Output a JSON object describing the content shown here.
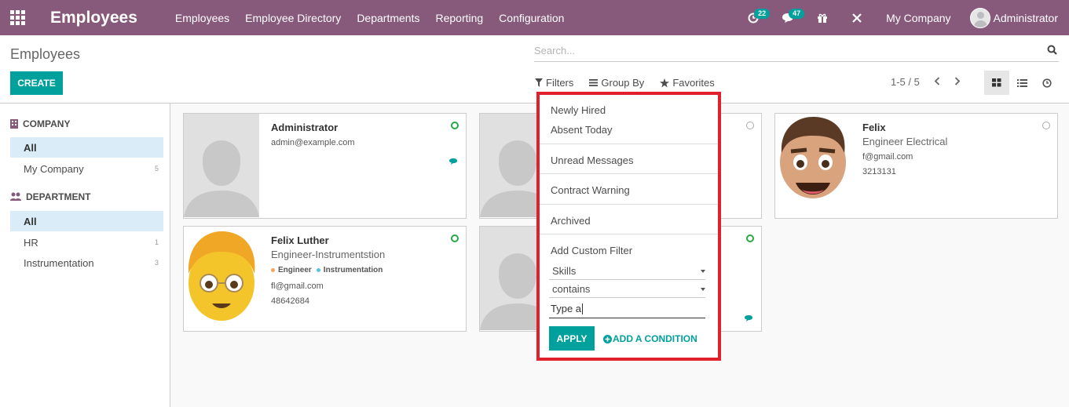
{
  "app": {
    "title": "Employees",
    "menu": [
      "Employees",
      "Employee Directory",
      "Departments",
      "Reporting",
      "Configuration"
    ],
    "activity_badge": "22",
    "messages_badge": "47",
    "company": "My Company",
    "user": "Administrator"
  },
  "control_panel": {
    "breadcrumb": "Employees",
    "create_label": "CREATE",
    "search_placeholder": "Search...",
    "filters_label": "Filters",
    "groupby_label": "Group By",
    "favorites_label": "Favorites",
    "pager": "1-5 / 5"
  },
  "sidebar": {
    "company_title": "COMPANY",
    "company_items": [
      {
        "label": "All",
        "count": ""
      },
      {
        "label": "My Company",
        "count": "5"
      }
    ],
    "department_title": "DEPARTMENT",
    "department_items": [
      {
        "label": "All",
        "count": ""
      },
      {
        "label": "HR",
        "count": "1"
      },
      {
        "label": "Instrumentation",
        "count": "3"
      }
    ]
  },
  "cards": [
    {
      "name": "Administrator",
      "email": "admin@example.com"
    },
    {
      "name": "Felix",
      "job": "Engineer Electrical",
      "email": "f@gmail.com",
      "phone": "3213131"
    },
    {
      "name": "Felix Luther",
      "job": "Engineer-Instrumentstion",
      "tags": [
        "Engineer",
        "Instrumentation"
      ],
      "email": "fl@gmail.com",
      "phone": "48642684"
    }
  ],
  "filter_dropdown": {
    "items": [
      "Newly Hired",
      "Absent Today",
      "Unread Messages",
      "Contract Warning",
      "Archived"
    ],
    "custom_title": "Add Custom Filter",
    "field": "Skills",
    "operator": "contains",
    "value": "Type a",
    "apply_label": "APPLY",
    "add_condition_label": "ADD A CONDITION"
  },
  "colors": {
    "navbar": "#875a7b",
    "primary": "#00a09d",
    "highlight_border": "#e0202d",
    "online": "#28a745"
  }
}
